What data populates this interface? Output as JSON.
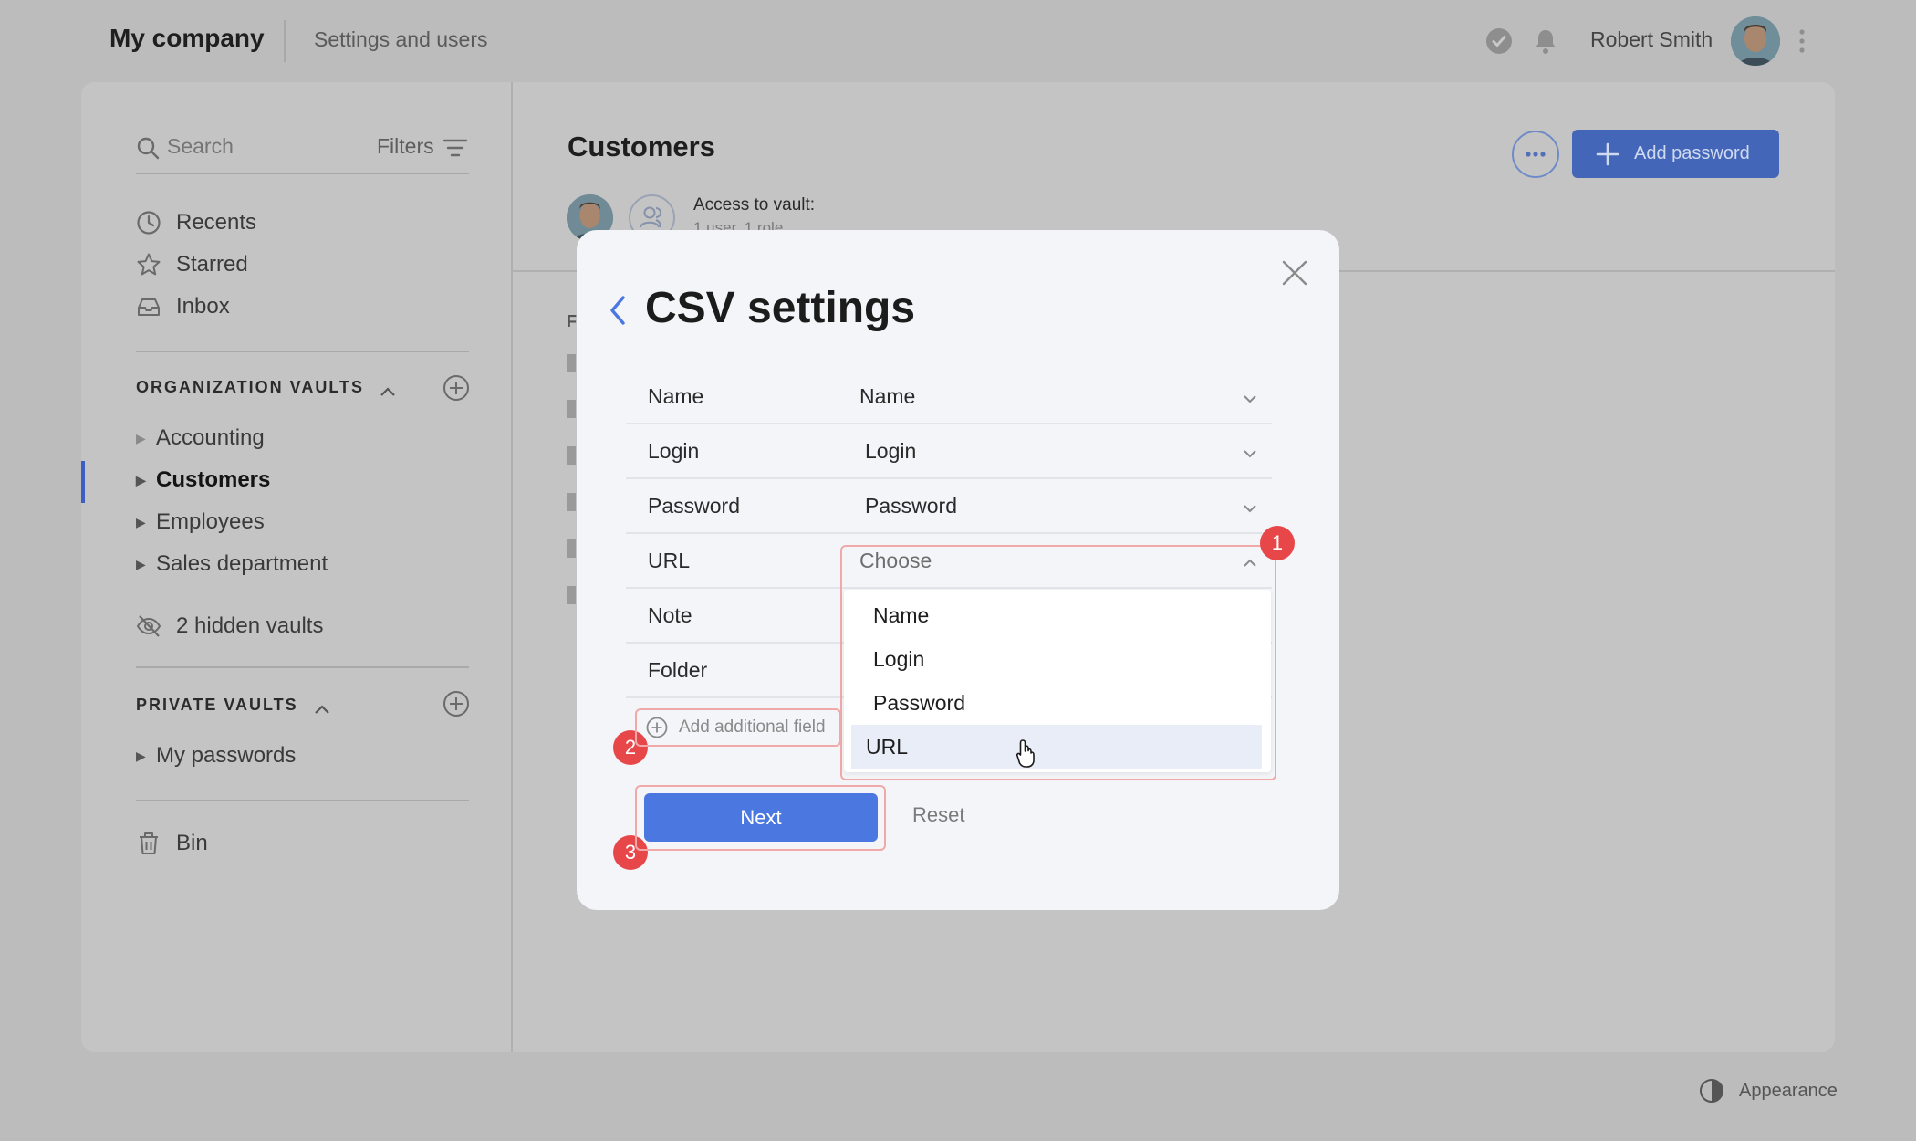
{
  "header": {
    "company": "My company",
    "settings_link": "Settings and users",
    "user_name": "Robert Smith"
  },
  "sidebar": {
    "search_placeholder": "Search",
    "filters_label": "Filters",
    "nav": [
      {
        "label": "Recents",
        "icon": "clock-icon"
      },
      {
        "label": "Starred",
        "icon": "star-icon"
      },
      {
        "label": "Inbox",
        "icon": "inbox-icon"
      }
    ],
    "org_section": "ORGANIZATION VAULTS",
    "org_vaults": [
      "Accounting",
      "Customers",
      "Employees",
      "Sales department"
    ],
    "active_vault": "Customers",
    "hidden_vaults": "2 hidden vaults",
    "private_section": "PRIVATE VAULTS",
    "private_vaults": [
      "My passwords"
    ],
    "bin": "Bin"
  },
  "content": {
    "title": "Customers",
    "add_password": "Add password",
    "access_label": "Access to vault:",
    "access_sub": "1 user, 1 role",
    "ghost_letter": "F"
  },
  "modal": {
    "title": "CSV settings",
    "rows": [
      {
        "label": "Name",
        "value": "Name"
      },
      {
        "label": "Login",
        "value": "Login"
      },
      {
        "label": "Password",
        "value": "Password"
      },
      {
        "label": "URL",
        "value": "Choose"
      },
      {
        "label": "Note",
        "value": ""
      },
      {
        "label": "Folder",
        "value": ""
      }
    ],
    "dropdown_options": [
      "Name",
      "Login",
      "Password",
      "URL"
    ],
    "hovered_option": "URL",
    "add_field": "Add additional field",
    "next": "Next",
    "reset": "Reset",
    "badges": [
      "1",
      "2",
      "3"
    ]
  },
  "footer": {
    "appearance": "Appearance"
  },
  "colors": {
    "accent": "#4a78e0",
    "badge": "#e8474a",
    "highlight_outline": "#f0a9a9"
  }
}
